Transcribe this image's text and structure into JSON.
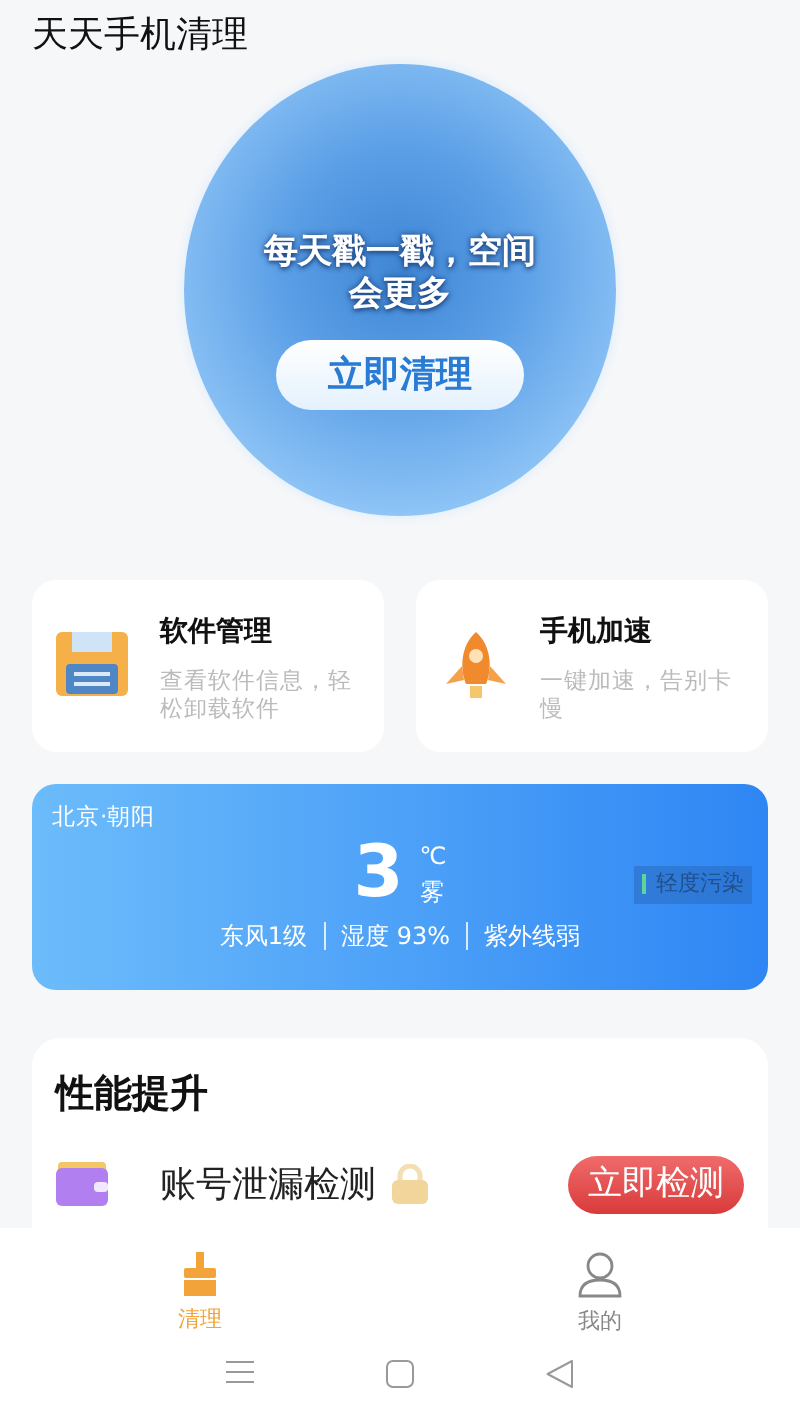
{
  "app_title": "天天手机清理",
  "hero": {
    "slogan": "每天戳一戳，空间会更多",
    "button": "立即清理"
  },
  "features": [
    {
      "kind": "floppy",
      "title": "软件管理",
      "desc": "查看软件信息，轻松卸载软件"
    },
    {
      "kind": "rocket",
      "title": "手机加速",
      "desc": "一键加速，告别卡慢"
    }
  ],
  "weather": {
    "location": "北京·朝阳",
    "temperature": "3",
    "unit": "℃",
    "condition": "雾",
    "air_quality": "轻度污染",
    "details": [
      "东风1级",
      "湿度 93%",
      "紫外线弱"
    ]
  },
  "performance": {
    "title": "性能提升",
    "items": [
      {
        "title": "账号泄漏检测",
        "locked": true,
        "button": "立即检测"
      }
    ]
  },
  "tabs": [
    {
      "kind": "broom",
      "label": "清理",
      "selected": true
    },
    {
      "kind": "person",
      "label": "我的",
      "selected": false
    }
  ]
}
